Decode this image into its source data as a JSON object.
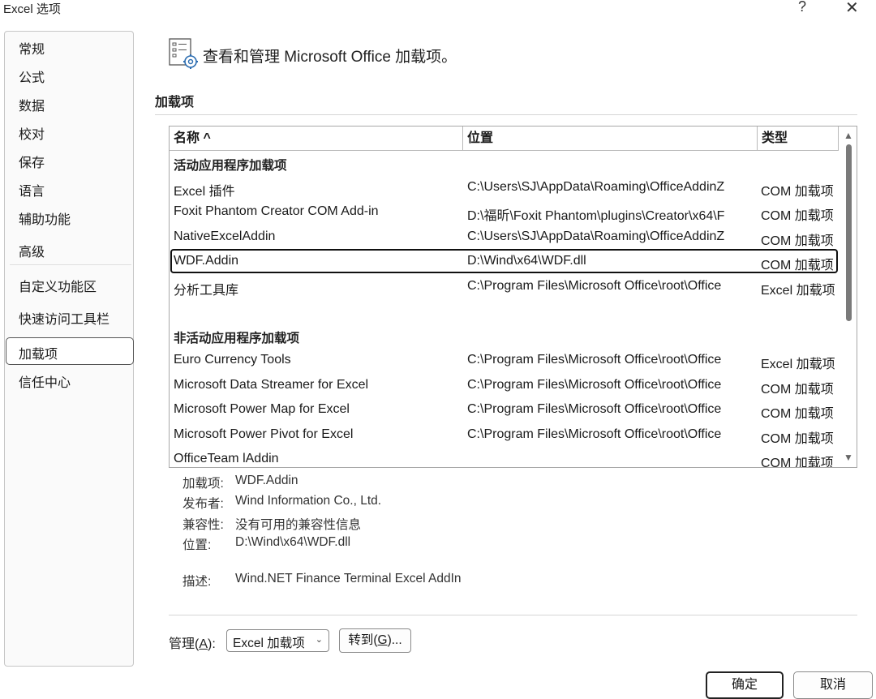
{
  "window": {
    "title": "Excel 选项",
    "help": "?",
    "close": "✕"
  },
  "sidebar": {
    "items": [
      {
        "label": "常规"
      },
      {
        "label": "公式"
      },
      {
        "label": "数据"
      },
      {
        "label": "校对"
      },
      {
        "label": "保存"
      },
      {
        "label": "语言"
      },
      {
        "label": "辅助功能"
      },
      {
        "label": "高级"
      },
      {
        "label": "自定义功能区"
      },
      {
        "label": "快速访问工具栏"
      },
      {
        "label": "加载项"
      },
      {
        "label": "信任中心"
      }
    ],
    "selected": "加载项"
  },
  "header": {
    "text": "查看和管理 Microsoft Office 加载项。",
    "icon": "addins-gear-icon"
  },
  "section": {
    "title": "加载项"
  },
  "table": {
    "columns": [
      "名称 ^",
      "位置",
      "类型"
    ],
    "groups": [
      {
        "label": "活动应用程序加载项",
        "rows": [
          {
            "name": "Excel 插件",
            "location": "C:\\Users\\SJ\\AppData\\Roaming\\OfficeAddinZ",
            "type": "COM 加载项"
          },
          {
            "name": "Foxit Phantom Creator COM Add-in",
            "location": "D:\\福昕\\Foxit Phantom\\plugins\\Creator\\x64\\F",
            "type": "COM 加载项"
          },
          {
            "name": "NativeExcelAddin",
            "location": "C:\\Users\\SJ\\AppData\\Roaming\\OfficeAddinZ",
            "type": "COM 加载项"
          },
          {
            "name": "WDF.Addin",
            "location": "D:\\Wind\\x64\\WDF.dll",
            "type": "COM 加载项"
          },
          {
            "name": "分析工具库",
            "location": "C:\\Program Files\\Microsoft Office\\root\\Office",
            "type": "Excel 加载项"
          }
        ]
      },
      {
        "label": "非活动应用程序加载项",
        "rows": [
          {
            "name": "Euro Currency Tools",
            "location": "C:\\Program Files\\Microsoft Office\\root\\Office",
            "type": "Excel 加载项"
          },
          {
            "name": "Microsoft Data Streamer for Excel",
            "location": "C:\\Program Files\\Microsoft Office\\root\\Office",
            "type": "COM 加载项"
          },
          {
            "name": "Microsoft Power Map for Excel",
            "location": "C:\\Program Files\\Microsoft Office\\root\\Office",
            "type": "COM 加载项"
          },
          {
            "name": "Microsoft Power Pivot for Excel",
            "location": "C:\\Program Files\\Microsoft Office\\root\\Office",
            "type": "COM 加载项"
          },
          {
            "name": "OfficeTeam lAddin",
            "location": "",
            "type": "COM 加载项"
          }
        ]
      }
    ],
    "selected_row": "WDF.Addin",
    "scroll_up": "▲",
    "scroll_down": "▼"
  },
  "details": {
    "addin_label": "加载项:",
    "addin_value": "WDF.Addin",
    "publisher_label": "发布者:",
    "publisher_value": "Wind Information Co., Ltd.",
    "compat_label": "兼容性:",
    "compat_value": "没有可用的兼容性信息",
    "location_label": "位置:",
    "location_value": "D:\\Wind\\x64\\WDF.dll",
    "desc_label": "描述:",
    "desc_value": "Wind.NET Finance Terminal Excel AddIn"
  },
  "manage": {
    "label_pre": "管理(",
    "label_key": "A",
    "label_post": "):",
    "selected": "Excel 加载项",
    "goto_pre": "转到(",
    "goto_key": "G",
    "goto_post": ")..."
  },
  "buttons": {
    "ok": "确定",
    "cancel": "取消"
  },
  "colors": {
    "selection_border": "#111111",
    "scroll_thumb": "#7a7a7a"
  }
}
